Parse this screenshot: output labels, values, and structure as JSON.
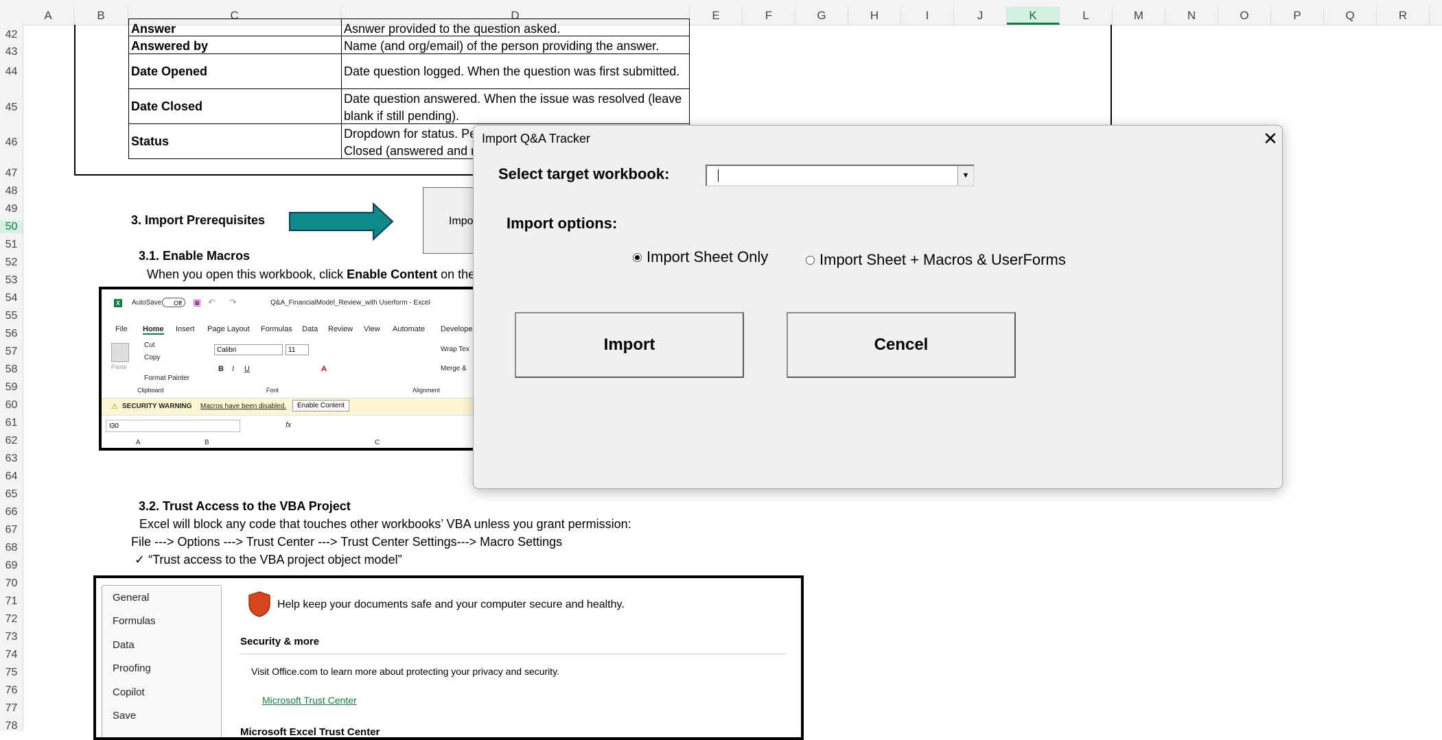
{
  "columns": [
    "A",
    "B",
    "C",
    "D",
    "E",
    "F",
    "G",
    "H",
    "I",
    "J",
    "K",
    "L",
    "M",
    "N",
    "O",
    "P",
    "Q",
    "R"
  ],
  "selected_column": "K",
  "rows": [
    "42",
    "43",
    "44",
    "45",
    "46",
    "47",
    "48",
    "49",
    "50",
    "51",
    "52",
    "53",
    "54",
    "55",
    "56",
    "57",
    "58",
    "59",
    "60",
    "61",
    "62",
    "63",
    "64",
    "65",
    "66",
    "67",
    "68",
    "69",
    "70",
    "71",
    "72",
    "73",
    "74",
    "75",
    "76",
    "77",
    "78"
  ],
  "selected_row": "50",
  "definitions": [
    {
      "field": "Answer",
      "desc": "Asnwer provided to the question asked."
    },
    {
      "field": "Answered by",
      "desc": "Name (and org/email) of the person providing the answer."
    },
    {
      "field": "Date Opened",
      "desc": "Date question logged. When the question was first submitted."
    },
    {
      "field": "Date Closed",
      "desc": "Date question answered. When the issue was resolved (leave blank if still pending)."
    },
    {
      "field": "Status",
      "desc_line1": "Dropdown for status. Pe",
      "desc_line2": "Closed (answered and r"
    }
  ],
  "section3": {
    "title": "3.  Import Prerequisites",
    "button_partial": "Impo",
    "sub1_title": "3.1. Enable Macros",
    "sub1_text_pre": "When you open this workbook, click ",
    "sub1_text_bold": "Enable Content",
    "sub1_text_post": " on the",
    "sub2_title": "3.2. Trust Access to the VBA Project",
    "sub2_line1": "Excel will block any code that touches other workbooks’ VBA unless you grant permission:",
    "sub2_line2": "File ---> Options ---> Trust Center ---> Trust Center Settings---> Macro Settings",
    "sub2_line3": "✓ “Trust access to the VBA project object model”"
  },
  "excel_shot": {
    "autosave": "AutoSave",
    "toggle": "Off",
    "filename": "Q&A_FinancialModel_Review_with Userform  -  Excel",
    "tabs": [
      "File",
      "Home",
      "Insert",
      "Page Layout",
      "Formulas",
      "Data",
      "Review",
      "View",
      "Automate",
      "Developer"
    ],
    "paste": "Paste",
    "cut": "Cut",
    "copy": "Copy",
    "format_painter": "Format Painter",
    "clipboard": "Clipboard",
    "font_name": "Calibri",
    "font_size": "11",
    "font_group": "Font",
    "alignment": "Alignment",
    "wrap": "Wrap Tex",
    "merge": "Merge &",
    "security_label": "SECURITY WARNING",
    "security_msg": "Macros have been disabled.",
    "enable_btn": "Enable Content",
    "namebox": "I30",
    "fx": "fx",
    "col_a": "A",
    "col_b": "B",
    "col_c": "C"
  },
  "dialog": {
    "title": "Import Q&A Tracker",
    "select_label": "Select target workbook:",
    "select_value": "",
    "options_label": "Import options:",
    "option1": "Import Sheet Only",
    "option2": "Import Sheet + Macros & UserForms",
    "selected_option": 1,
    "import_btn": "Import",
    "cancel_btn": "Cencel"
  },
  "trust_shot": {
    "nav": [
      "General",
      "Formulas",
      "Data",
      "Proofing",
      "Copilot",
      "Save"
    ],
    "headline": "Help keep your documents safe and your computer secure and healthy.",
    "section1": "Security & more",
    "visit": "Visit Office.com to learn more about protecting your privacy and security.",
    "link": "Microsoft Trust Center",
    "section2": "Microsoft Excel Trust Center"
  },
  "colors": {
    "accent": "#107c41",
    "arrow": "#0e8a8a",
    "link": "#107c41"
  }
}
